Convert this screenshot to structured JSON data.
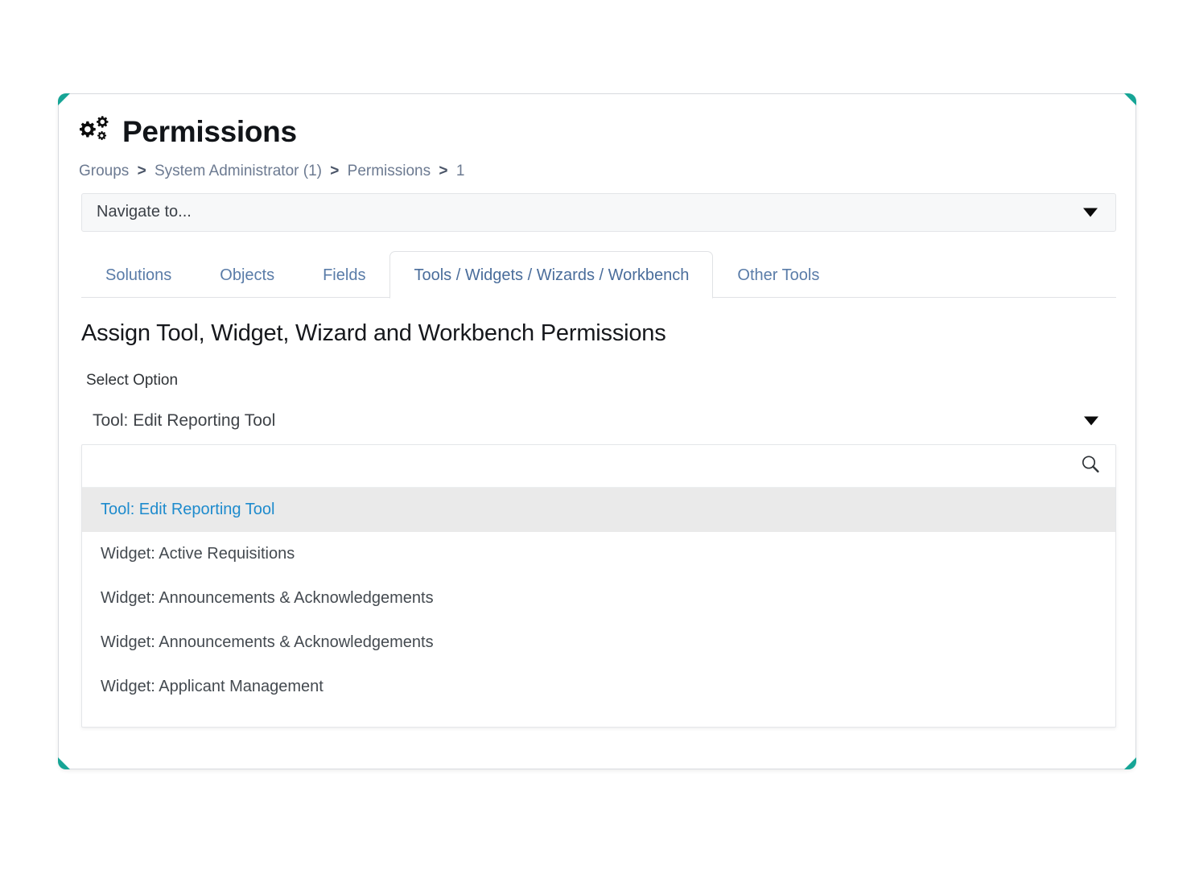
{
  "theme": {
    "accent_teal": "#16a596",
    "tab_link": "#5a7ca8",
    "highlight_blue": "#1e8bcd",
    "highlight_bg": "#eaeaea",
    "breadcrumb_gray": "#6c7a91"
  },
  "header": {
    "icon": "cogs-icon",
    "title": "Permissions"
  },
  "breadcrumb": {
    "separator": ">",
    "items": [
      {
        "label": "Groups"
      },
      {
        "label": "System Administrator (1)"
      },
      {
        "label": "Permissions"
      },
      {
        "label": "1"
      }
    ]
  },
  "navigate_select": {
    "label": "Navigate to...",
    "caret_icon": "chevron-down-icon"
  },
  "tabs": [
    {
      "label": "Solutions",
      "active": false
    },
    {
      "label": "Objects",
      "active": false
    },
    {
      "label": "Fields",
      "active": false
    },
    {
      "label": "Tools / Widgets / Wizards / Workbench",
      "active": true
    },
    {
      "label": "Other Tools",
      "active": false
    }
  ],
  "main": {
    "section_title": "Assign Tool, Widget, Wizard and Workbench Permissions",
    "field_label": "Select Option",
    "selected_value": "Tool: Edit Reporting Tool",
    "caret_icon": "chevron-down-icon"
  },
  "dropdown": {
    "search": {
      "value": "",
      "placeholder": "",
      "icon": "search-icon"
    },
    "options": [
      {
        "label": "Tool: Edit Reporting Tool",
        "highlighted": true
      },
      {
        "label": "Widget: Active Requisitions",
        "highlighted": false
      },
      {
        "label": "Widget: Announcements & Acknowledgements",
        "highlighted": false
      },
      {
        "label": "Widget: Announcements & Acknowledgements",
        "highlighted": false
      },
      {
        "label": "Widget: Applicant Management",
        "highlighted": false
      }
    ]
  }
}
